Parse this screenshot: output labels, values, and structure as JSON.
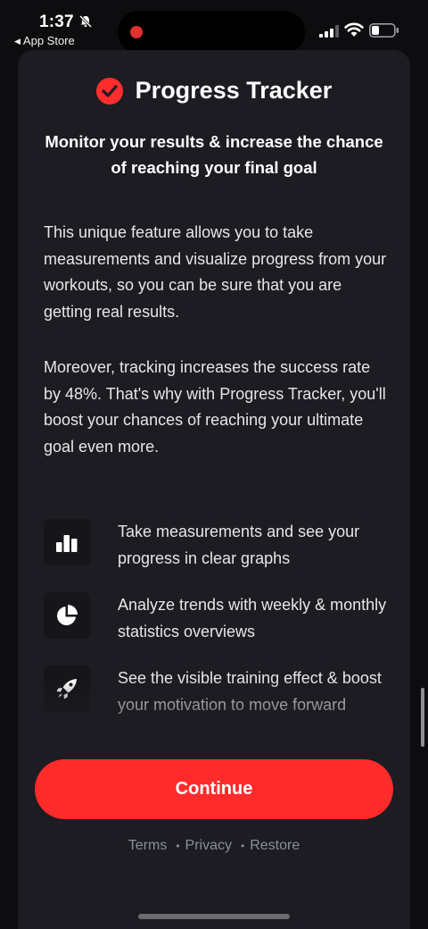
{
  "status_bar": {
    "time": "1:37",
    "back_label": "App Store"
  },
  "header": {
    "title": "Progress Tracker",
    "subtitle": "Monitor your results & increase the chance of reaching your final goal"
  },
  "body": {
    "paragraph_1": "This unique feature allows you to take measurements and visualize progress from your workouts, so you can be sure that you are getting real results.",
    "paragraph_2": "Moreover, tracking increases the success rate by 48%. That's why with Progress Tracker, you'll boost your chances of reaching your ultimate goal even more."
  },
  "features": [
    {
      "icon": "bar-chart-icon",
      "text": "Take measurements and see your progress in clear graphs"
    },
    {
      "icon": "pie-chart-icon",
      "text": "Analyze trends with weekly & monthly statistics overviews"
    },
    {
      "icon": "rocket-icon",
      "text": "See the visible training effect & boost your motivation to move forward"
    }
  ],
  "actions": {
    "continue_label": "Continue"
  },
  "footer": {
    "links": [
      "Terms",
      "Privacy",
      "Restore"
    ],
    "separator": "•"
  },
  "colors": {
    "accent": "#ff2b2b",
    "sheet_background": "#1c1c22",
    "footer_link": "#8a8f9c"
  }
}
